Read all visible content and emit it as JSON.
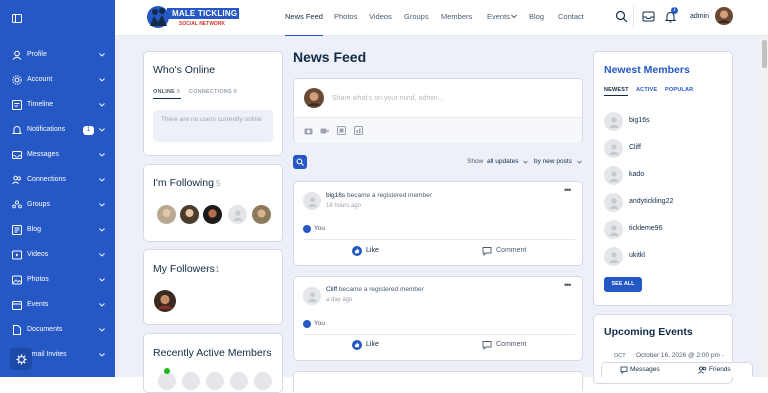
{
  "sidebar": {
    "items": [
      {
        "label": "Profile",
        "icon": "user-icon"
      },
      {
        "label": "Account",
        "icon": "gear-icon"
      },
      {
        "label": "Timeline",
        "icon": "timeline-icon"
      },
      {
        "label": "Notifications",
        "icon": "bell-icon",
        "badge": "1"
      },
      {
        "label": "Messages",
        "icon": "inbox-icon"
      },
      {
        "label": "Connections",
        "icon": "users-icon"
      },
      {
        "label": "Groups",
        "icon": "groups-icon"
      },
      {
        "label": "Blog",
        "icon": "blog-icon"
      },
      {
        "label": "Videos",
        "icon": "video-icon"
      },
      {
        "label": "Photos",
        "icon": "photo-icon"
      },
      {
        "label": "Events",
        "icon": "calendar-icon"
      },
      {
        "label": "Documents",
        "icon": "document-icon"
      },
      {
        "label": "Email Invites",
        "icon": "email-icon"
      }
    ]
  },
  "header": {
    "logo_line1": "MALE TICKLING",
    "logo_line2": "SOCIAL NETWORK",
    "nav": [
      "News Feed",
      "Photos",
      "Videos",
      "Groups",
      "Members",
      "Events",
      "Blog",
      "Contact"
    ],
    "notification_count": "1",
    "user_name": "admin"
  },
  "whos_online": {
    "title": "Who's Online",
    "tab_online": "ONLINE",
    "tab_online_count": "0",
    "tab_connections": "CONNECTIONS",
    "tab_connections_count": "0",
    "empty_text": "There are no users currently online"
  },
  "following": {
    "title": "I'm Following",
    "count": "5"
  },
  "followers": {
    "title": "My Followers",
    "count": "1"
  },
  "recently_active": {
    "title": "Recently Active Members"
  },
  "feed": {
    "title": "News Feed",
    "placeholder": "Share what's on your mind, admin...",
    "show_label": "Show",
    "filter": "all updates",
    "sort_label": "by new posts",
    "posts": [
      {
        "user": "big16s",
        "action": "became a registered member",
        "time": "18 hours ago",
        "reaction": "You",
        "like": "Like",
        "comment": "Comment"
      },
      {
        "user": "Cliff",
        "action": "became a registered member",
        "time": "a day ago",
        "reaction": "You",
        "like": "Like",
        "comment": "Comment"
      }
    ]
  },
  "newest_members": {
    "title": "Newest Members",
    "tabs": [
      "NEWEST",
      "ACTIVE",
      "POPULAR"
    ],
    "members": [
      "big16s",
      "Cliff",
      "kado",
      "andytickling22",
      "tickleme96",
      "ukitkl"
    ],
    "see_all": "SEE ALL"
  },
  "upcoming_events": {
    "title": "Upcoming Events",
    "month": "OCT",
    "date_text": "October 16, 2026 @ 2:00 pm -"
  },
  "bottom_bar": {
    "messages": "Messages",
    "friends": "Friends"
  },
  "colors": {
    "brand": "#2557c5",
    "text": "#122b46",
    "background": "#eef0f9"
  }
}
